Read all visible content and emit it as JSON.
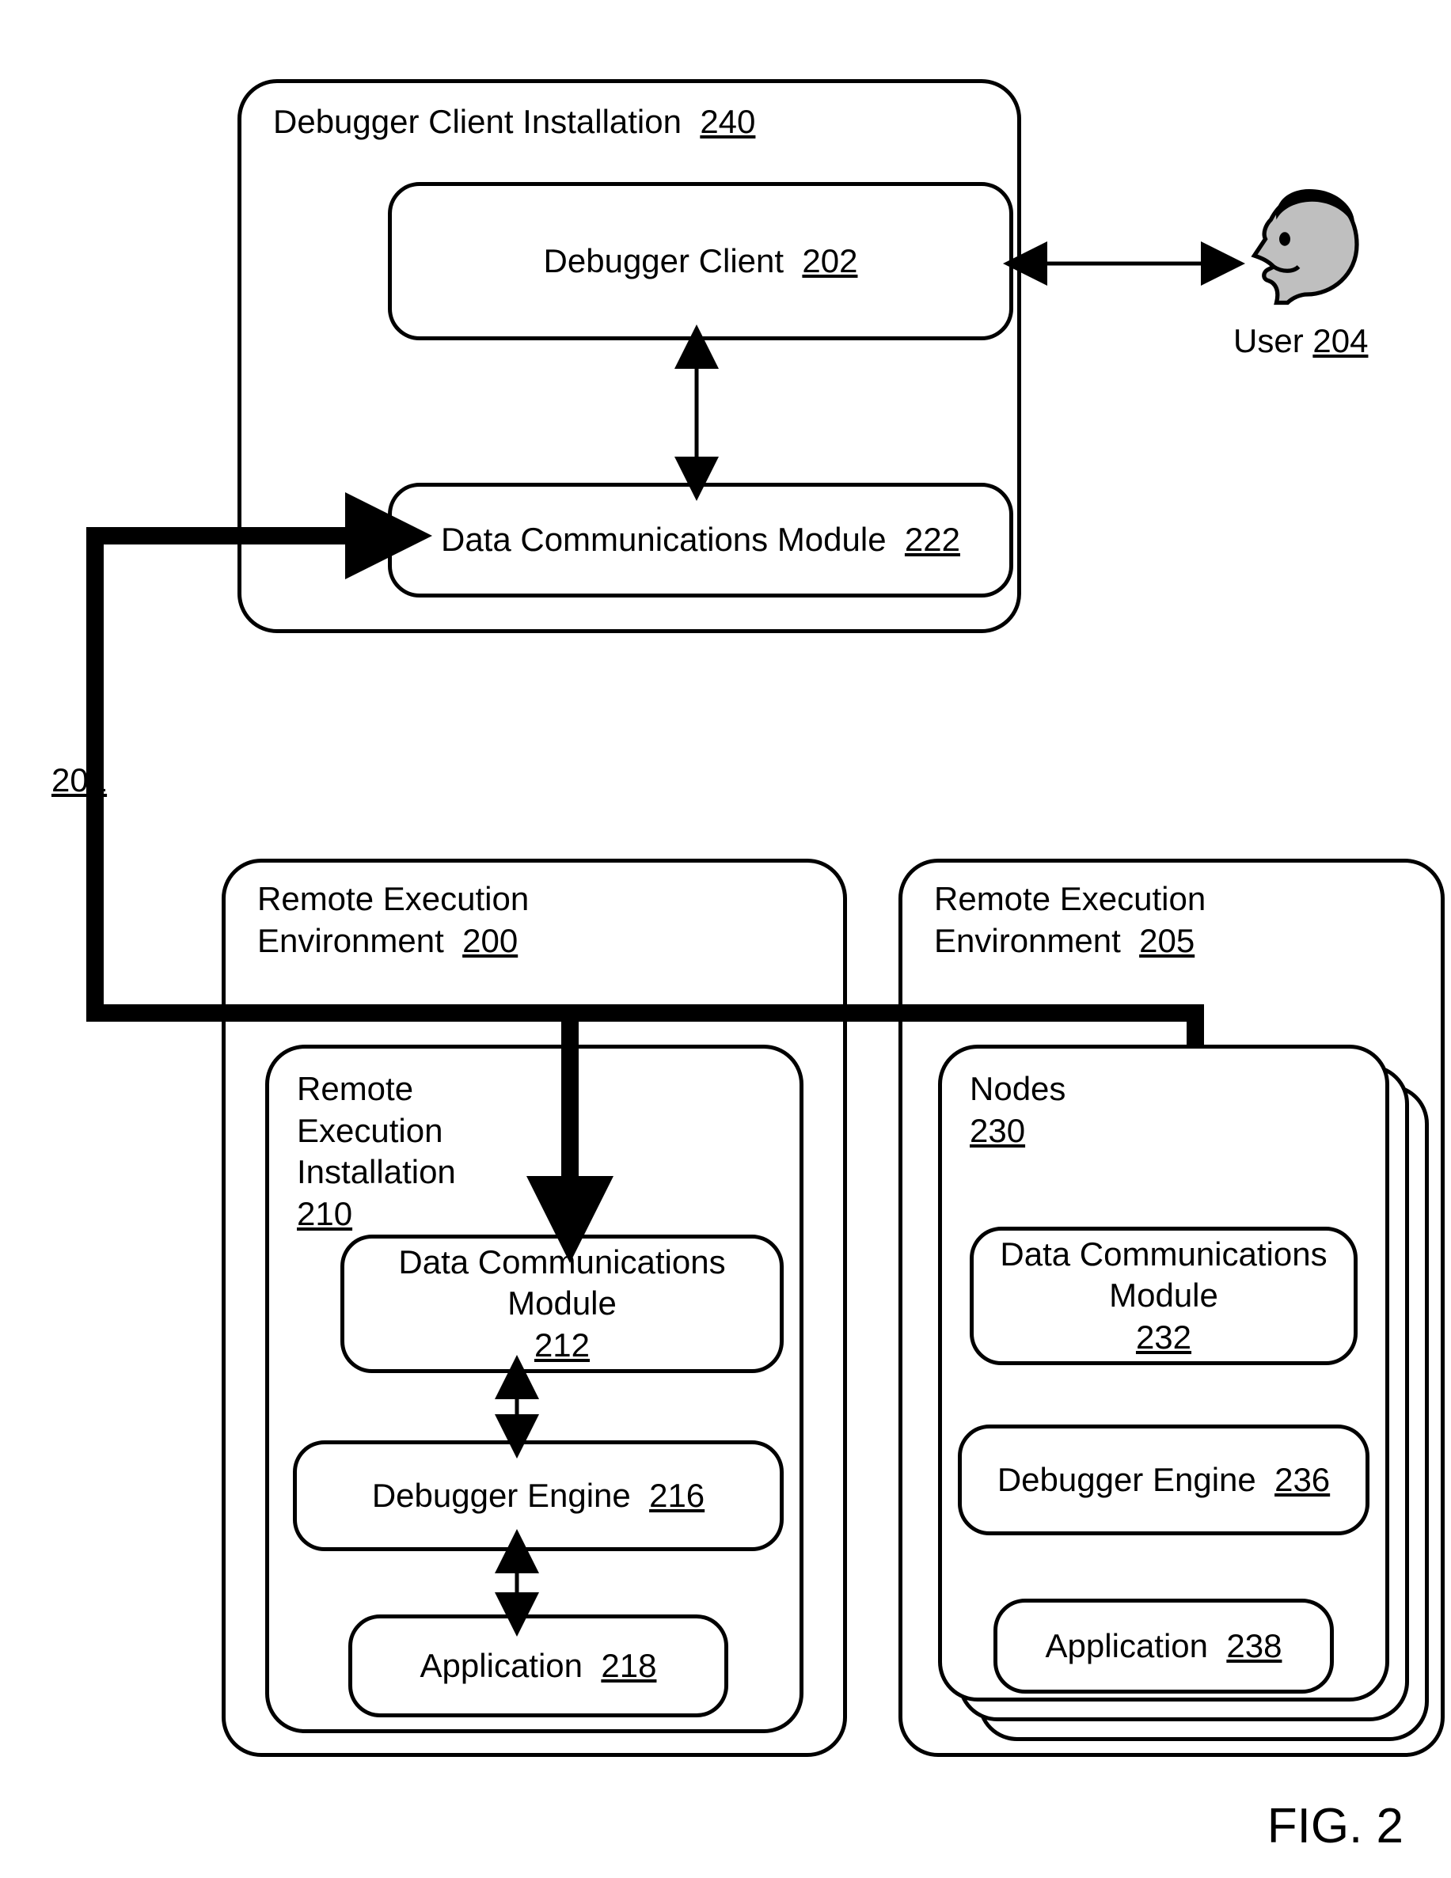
{
  "fig": "FIG. 2",
  "network_ref": "201",
  "top": {
    "title_text": "Debugger Client Installation",
    "title_ref": "240",
    "client_text": "Debugger Client",
    "client_ref": "202",
    "dcm_text": "Data Communications Module",
    "dcm_ref": "222"
  },
  "user": {
    "label": "User",
    "ref": "204"
  },
  "left": {
    "title_text": "Remote Execution Environment",
    "title_ref": "200",
    "inner_title_l1": "Remote",
    "inner_title_l2": "Execution",
    "inner_title_l3": "Installation",
    "inner_ref": "210",
    "dcm_text": "Data Communications Module",
    "dcm_ref": "212",
    "engine_text": "Debugger Engine",
    "engine_ref": "216",
    "app_text": "Application",
    "app_ref": "218"
  },
  "right": {
    "title_text": "Remote Execution Environment",
    "title_ref": "205",
    "nodes_text": "Nodes",
    "nodes_ref": "230",
    "dcm_text": "Data Communications Module",
    "dcm_ref": "232",
    "engine_text": "Debugger Engine",
    "engine_ref": "236",
    "app_text": "Application",
    "app_ref": "238"
  }
}
